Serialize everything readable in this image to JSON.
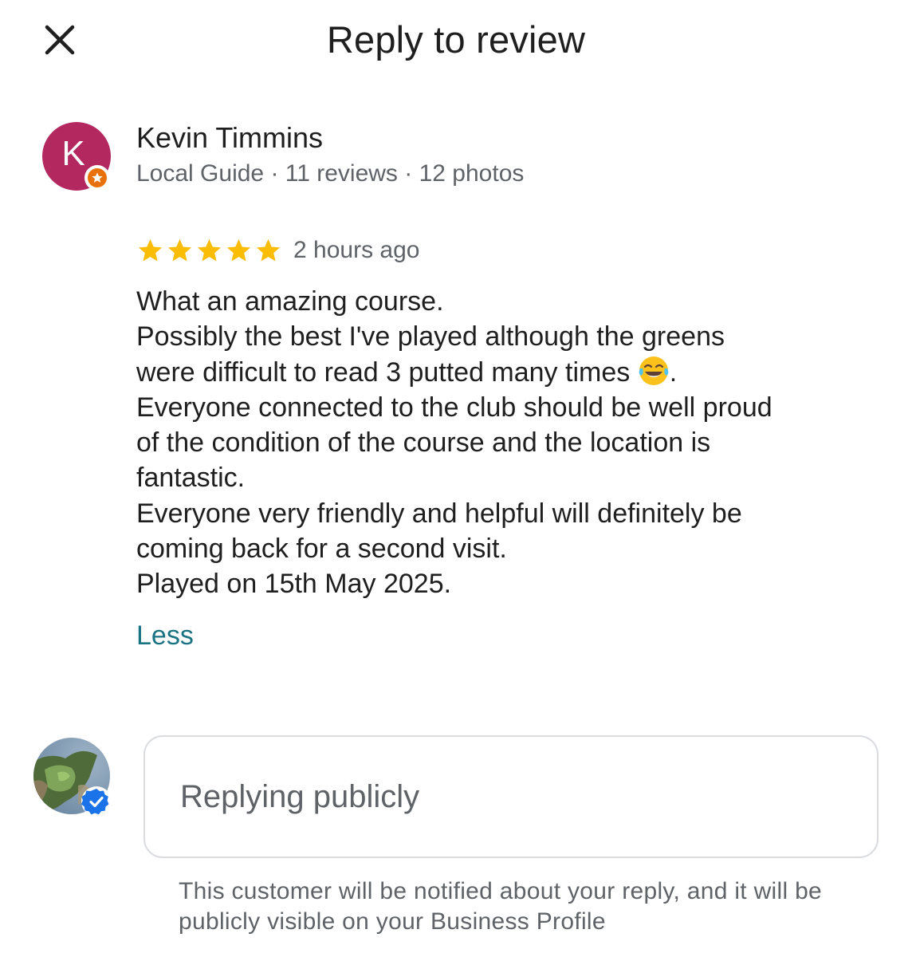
{
  "header": {
    "title": "Reply to review",
    "close_icon": "close-icon"
  },
  "reviewer": {
    "initial": "K",
    "name": "Kevin Timmins",
    "meta": "Local Guide · 11 reviews · 12 photos",
    "avatar_color": "#b3285f",
    "badge_icon": "local-guide-star-icon"
  },
  "review": {
    "rating": 5,
    "max_rating": 5,
    "time": "2 hours ago",
    "lines": [
      "What an amazing course.",
      "Possibly the best I've played although the greens",
      "were difficult to read 3 putted many times",
      "Everyone connected to the club should be well proud",
      "of the condition of the course and the location is",
      "fantastic.",
      "Everyone very friendly and helpful will definitely be",
      "coming back for a second visit.",
      "Played on 15th May 2025."
    ],
    "line3_suffix": ".",
    "emoji_icon": "tears-of-joy-emoji-icon",
    "less_label": "Less"
  },
  "reply": {
    "placeholder": "Replying publicly",
    "value": "",
    "owner_badge_icon": "verified-check-icon",
    "notice": "This customer will be notified about your reply, and it will be publicly visible on your Business Profile"
  },
  "colors": {
    "star": "#fbbc04",
    "link": "#1a7383",
    "verified": "#1a73e8",
    "secondary_text": "#5f6368"
  }
}
